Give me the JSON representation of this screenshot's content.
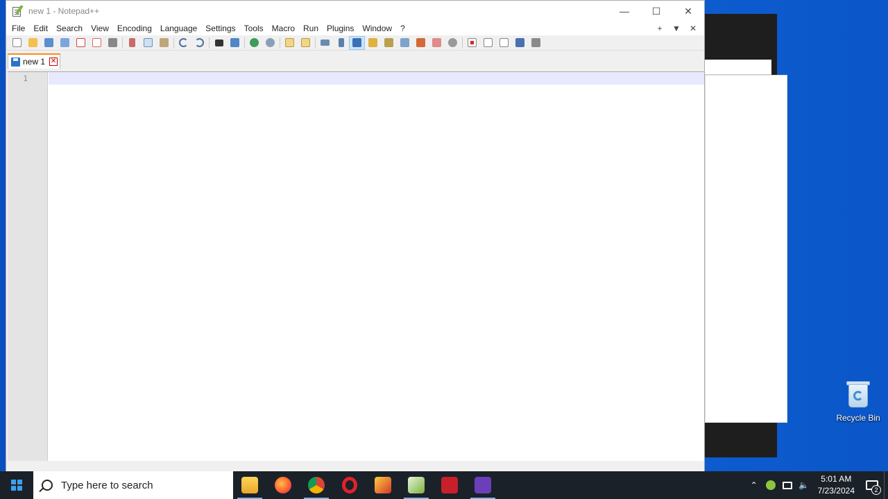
{
  "window": {
    "title": "new 1 - Notepad++",
    "controls": {
      "minimize": "—",
      "maximize": "☐",
      "close": "✕"
    }
  },
  "menu": {
    "items": [
      "File",
      "Edit",
      "Search",
      "View",
      "Encoding",
      "Language",
      "Settings",
      "Tools",
      "Macro",
      "Run",
      "Plugins",
      "Window",
      "?"
    ],
    "right": {
      "add": "+",
      "dropdown": "▼",
      "close": "✕"
    }
  },
  "toolbar": {
    "icons": [
      "new-file",
      "open-file",
      "save",
      "save-all",
      "close",
      "close-all",
      "print",
      "cut",
      "copy",
      "paste",
      "undo",
      "redo",
      "find",
      "replace",
      "zoom-in",
      "zoom-out",
      "sync-vertical",
      "sync-horizontal",
      "word-wrap",
      "show-all-characters",
      "indent-guide",
      "user-defined-language",
      "document-map",
      "document-list",
      "function-list",
      "folder-as-workspace",
      "monitoring",
      "record-macro",
      "stop-recording",
      "playback-macro",
      "run-macro-multiple",
      "save-macro"
    ]
  },
  "tabs": [
    {
      "label": "new 1",
      "close": "✕"
    }
  ],
  "editor": {
    "line_numbers": [
      "1"
    ],
    "content": ""
  },
  "desktop": {
    "recycle_bin_label": "Recycle Bin"
  },
  "taskbar": {
    "search_placeholder": "Type here to search",
    "apps": [
      "file-explorer",
      "firefox",
      "chrome",
      "opera",
      "file-manager",
      "notepad-plus-plus",
      "pdf-reader",
      "visual-studio"
    ],
    "clock": {
      "time": "5:01 AM",
      "date": "7/23/2024"
    },
    "notification_count": "2"
  },
  "colors": {
    "tab_accent": "#fa8c1a",
    "current_line": "#e8e8ff",
    "desktop_bg": "#0d63d8",
    "taskbar_bg": "#1b2129"
  }
}
